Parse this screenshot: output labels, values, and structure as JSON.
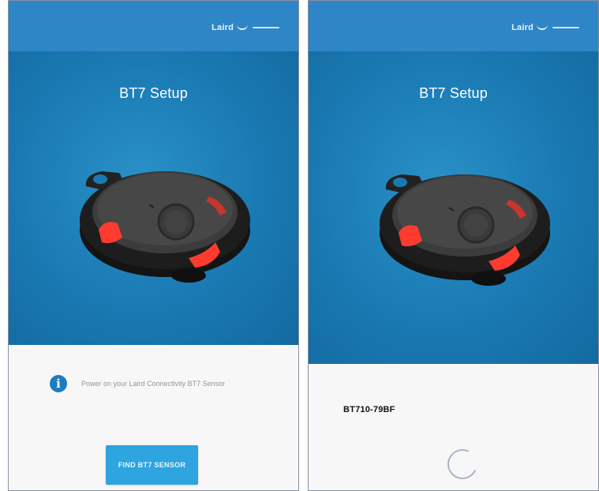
{
  "screens": [
    {
      "header": {
        "logo_text": "Laird"
      },
      "title": "BT7 Setup",
      "info_message": "Power on your Laird Connectivity BT7 Sensor",
      "find_button_label": "FIND BT7 SENSOR"
    },
    {
      "header": {
        "logo_text": "Laird"
      },
      "title": "BT7 Setup",
      "device_name": "BT710-79BF",
      "spinner": "loading-spinner"
    }
  ],
  "colors": {
    "header_blue": "#2f86c6",
    "hero_blue": "#1a79b2",
    "button_blue": "#2ea4e0",
    "led_red": "#ff3b30"
  },
  "icons": {
    "info": "info-icon",
    "device_image": "bt7-sensor-device"
  }
}
